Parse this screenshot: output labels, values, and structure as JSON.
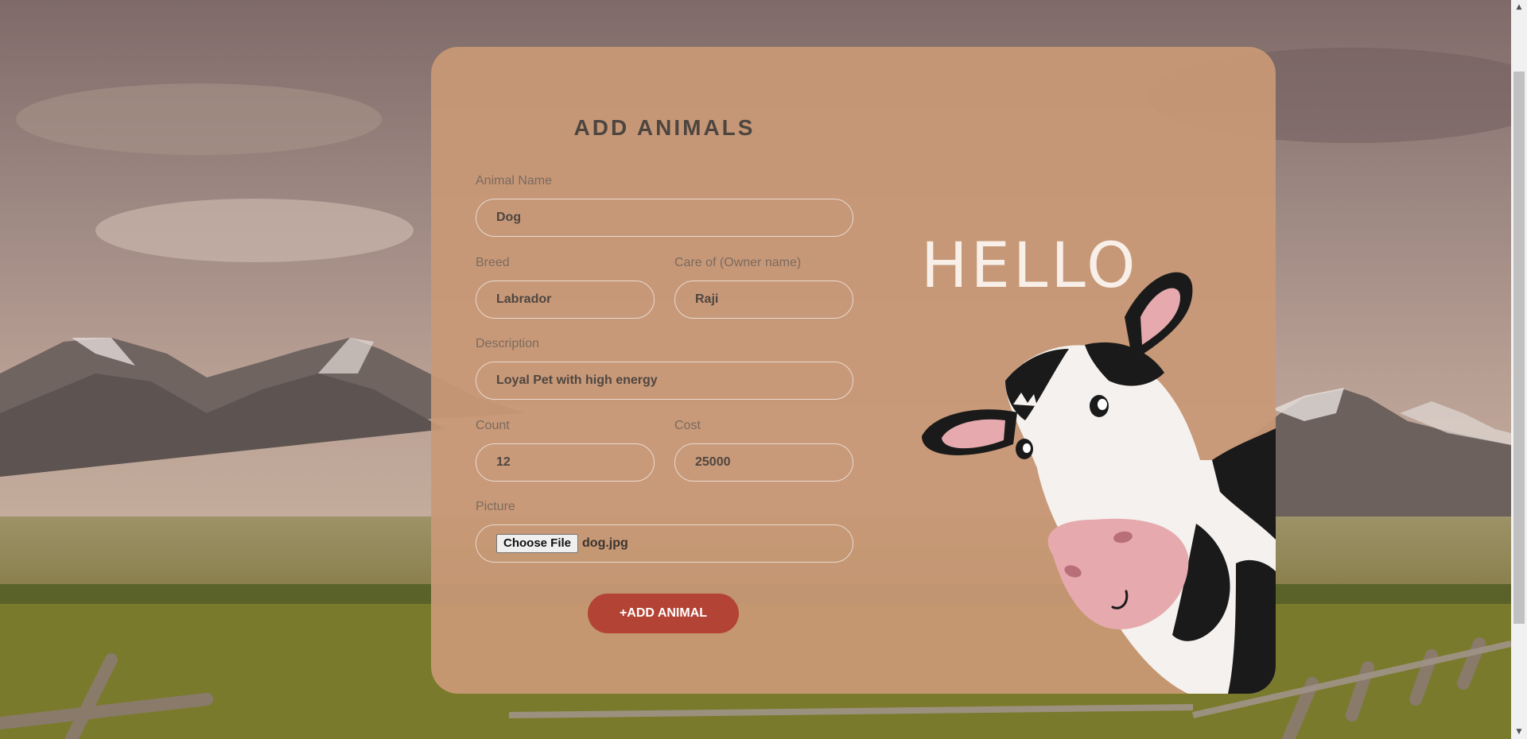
{
  "page": {
    "title": "ADD ANIMALS",
    "submit_label": "+ADD ANIMAL",
    "accent_color": "#b34334"
  },
  "form": {
    "animal_name": {
      "label": "Animal Name",
      "value": "Dog"
    },
    "breed": {
      "label": "Breed",
      "value": "Labrador"
    },
    "care_of": {
      "label": "Care of (Owner name)",
      "value": "Raji"
    },
    "description": {
      "label": "Description",
      "value": "Loyal Pet with high energy"
    },
    "count": {
      "label": "Count",
      "value": "12"
    },
    "cost": {
      "label": "Cost",
      "value": "25000"
    },
    "picture": {
      "label": "Picture",
      "button_label": "Choose File",
      "file_name": "dog.jpg"
    }
  },
  "illustration": {
    "greeting": "HELLO",
    "subject": "cartoon-cow"
  },
  "icons": {
    "scroll_up": "▲",
    "scroll_down": "▼"
  }
}
